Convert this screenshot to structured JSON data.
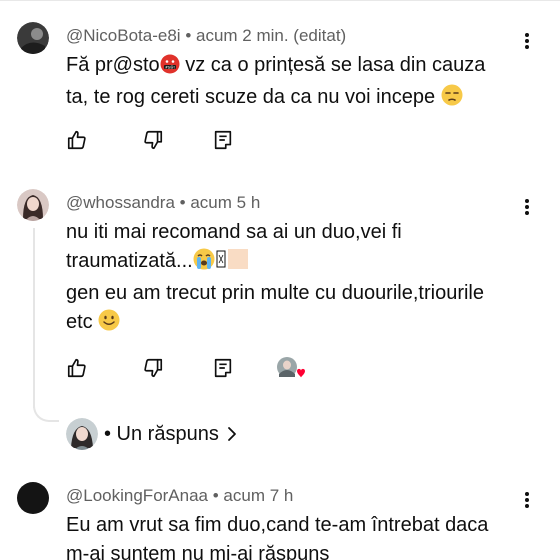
{
  "comments": [
    {
      "author": "@NicoBota-e8i",
      "time": "acum 2 min. (editat)",
      "text_a": "Fă pr@sto",
      "text_b": " vz ca o prințesă se lasa din cauza",
      "text_c": "ta, te rog cereti scuze da ca nu voi incepe ",
      "avatar_color": "#3a3a3a"
    },
    {
      "author": "@whossandra",
      "time": "acum 5 h",
      "line1": "nu iti mai recomand sa ai un duo,vei fi",
      "line2": "traumatizată...",
      "line3": "gen eu am trecut prin multe cu duourile,triourile",
      "line4": "etc ",
      "avatar_color": "#8a6f6f"
    },
    {
      "author": "@LookingForAnaa",
      "time": "acum 7 h",
      "line1": "Eu am vrut sa fim duo,cand te-am întrebat daca",
      "line2": "m-ai suntem nu mi-ai răspuns",
      "avatar_color": "#141414"
    }
  ],
  "meta_separator": " • ",
  "replies": {
    "label": "• Un răspuns"
  },
  "icons": {
    "like": "thumbs-up-icon",
    "dislike": "thumbs-down-icon",
    "reply": "reply-icon",
    "more": "more-vertical-icon",
    "heart": "creator-heart-icon",
    "chevron": "chevron-right-icon"
  },
  "colors": {
    "meta": "#606060",
    "text": "#0f0f0f",
    "heart": "#ff0033",
    "thread": "#e5e5e5"
  }
}
